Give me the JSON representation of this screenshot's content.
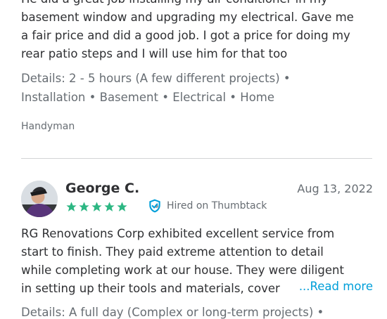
{
  "review_one": {
    "text": "He did a great job installing my air conditioner in my\nbasement window and upgrading my electrical. Gave me\na fair price and did a good job. I got a price for doing my\nrear patio steps and I will use him for that too",
    "details_label": "Details:",
    "details_parts": [
      "2 - 5 hours (A few different projects)",
      "Installation",
      "Basement",
      "Electrical",
      "Home"
    ],
    "separator": "•",
    "category": "Handyman"
  },
  "review_two": {
    "reviewer_name": "George C.",
    "date": "Aug 13, 2022",
    "rating": 5,
    "hired_label": "Hired on Thumbtack",
    "text_lines": [
      "RG Renovations Corp exhibited excellent service from",
      "start to finish. They paid extreme attention to detail",
      "while completing work at our house. They were diligent",
      "in setting up their tools and materials, cover"
    ],
    "faded_suffix": "",
    "read_more": "...Read more",
    "details_prefix": "Details: A full day (Complex or long-term projects) •"
  },
  "colors": {
    "star": "#2db783",
    "shield": "#009fd9",
    "link": "#009fd9"
  },
  "icons": {
    "avatar": "reviewer-avatar-photo",
    "star": "star-icon",
    "shield": "shield-check-icon"
  }
}
